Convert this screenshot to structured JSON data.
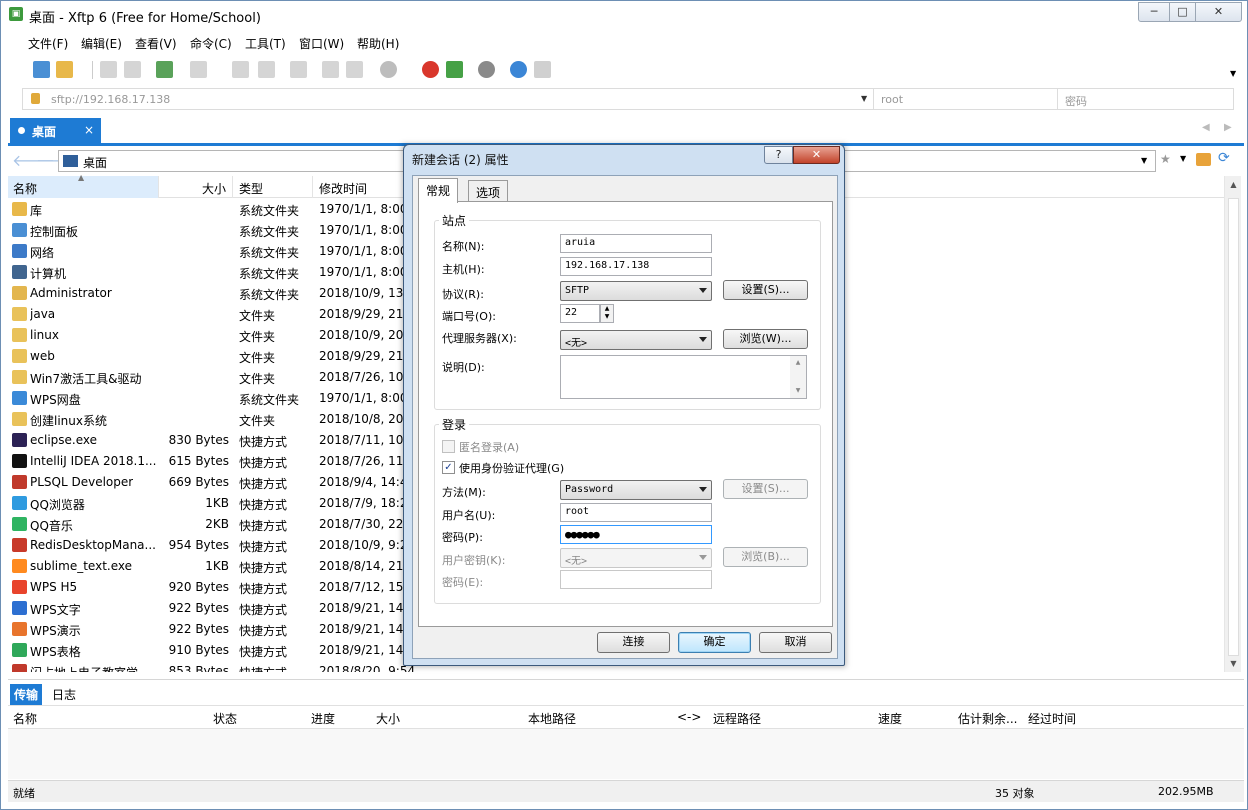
{
  "window": {
    "title": "桌面 - Xftp 6 (Free for Home/School)",
    "min": "─",
    "max": "□",
    "close": "✕"
  },
  "menu": [
    "文件(F)",
    "编辑(E)",
    "查看(V)",
    "命令(C)",
    "工具(T)",
    "窗口(W)",
    "帮助(H)"
  ],
  "address": {
    "url": "sftp://192.168.17.138",
    "user_placeholder": "root",
    "password_placeholder": "密码"
  },
  "tab": {
    "label": "桌面",
    "close": "×"
  },
  "nav": {
    "path": "桌面"
  },
  "columns": {
    "name": "名称",
    "size": "大小",
    "type": "类型",
    "modified": "修改时间"
  },
  "files": [
    {
      "name": "库",
      "size": "",
      "type": "系统文件夹",
      "modified": "1970/1/1, 8:00",
      "icon": "library-icon",
      "color": "#e8b84a"
    },
    {
      "name": "控制面板",
      "size": "",
      "type": "系统文件夹",
      "modified": "1970/1/1, 8:00",
      "icon": "control-panel-icon",
      "color": "#4a8fd4"
    },
    {
      "name": "网络",
      "size": "",
      "type": "系统文件夹",
      "modified": "1970/1/1, 8:00",
      "icon": "network-icon",
      "color": "#3c7ac8"
    },
    {
      "name": "计算机",
      "size": "",
      "type": "系统文件夹",
      "modified": "1970/1/1, 8:00",
      "icon": "computer-icon",
      "color": "#40658f"
    },
    {
      "name": "Administrator",
      "size": "",
      "type": "系统文件夹",
      "modified": "2018/10/9, 13:",
      "icon": "user-folder-icon",
      "color": "#e3b64e"
    },
    {
      "name": "java",
      "size": "",
      "type": "文件夹",
      "modified": "2018/9/29, 21:",
      "icon": "folder-icon",
      "color": "#e9c25a"
    },
    {
      "name": "linux",
      "size": "",
      "type": "文件夹",
      "modified": "2018/10/9, 20:",
      "icon": "folder-icon",
      "color": "#e9c25a"
    },
    {
      "name": "web",
      "size": "",
      "type": "文件夹",
      "modified": "2018/9/29, 21:",
      "icon": "folder-icon",
      "color": "#e9c25a"
    },
    {
      "name": "Win7激活工具&驱动",
      "size": "",
      "type": "文件夹",
      "modified": "2018/7/26, 10:",
      "icon": "folder-icon",
      "color": "#e9c25a"
    },
    {
      "name": "WPS网盘",
      "size": "",
      "type": "系统文件夹",
      "modified": "1970/1/1, 8:00",
      "icon": "cloud-drive-icon",
      "color": "#3b8ad8"
    },
    {
      "name": "创建linux系统",
      "size": "",
      "type": "文件夹",
      "modified": "2018/10/8, 20:",
      "icon": "folder-icon",
      "color": "#e9c25a"
    },
    {
      "name": "eclipse.exe",
      "size": "830 Bytes",
      "type": "快捷方式",
      "modified": "2018/7/11, 10:",
      "icon": "eclipse-icon",
      "color": "#2c2255"
    },
    {
      "name": "IntelliJ IDEA 2018.1....",
      "size": "615 Bytes",
      "type": "快捷方式",
      "modified": "2018/7/26, 11:",
      "icon": "intellij-icon",
      "color": "#111111"
    },
    {
      "name": "PLSQL Developer",
      "size": "669 Bytes",
      "type": "快捷方式",
      "modified": "2018/9/4, 14:4",
      "icon": "plsql-icon",
      "color": "#c0392b"
    },
    {
      "name": "QQ浏览器",
      "size": "1KB",
      "type": "快捷方式",
      "modified": "2018/7/9, 18:2",
      "icon": "qq-browser-icon",
      "color": "#2f9be0"
    },
    {
      "name": "QQ音乐",
      "size": "2KB",
      "type": "快捷方式",
      "modified": "2018/7/30, 22:",
      "icon": "qq-music-icon",
      "color": "#2fb462"
    },
    {
      "name": "RedisDesktopMana...",
      "size": "954 Bytes",
      "type": "快捷方式",
      "modified": "2018/10/9, 9:2",
      "icon": "redis-icon",
      "color": "#c83a2a"
    },
    {
      "name": "sublime_text.exe",
      "size": "1KB",
      "type": "快捷方式",
      "modified": "2018/8/14, 21:",
      "icon": "sublime-icon",
      "color": "#ff8a1f"
    },
    {
      "name": "WPS H5",
      "size": "920 Bytes",
      "type": "快捷方式",
      "modified": "2018/7/12, 15:",
      "icon": "wps-h5-icon",
      "color": "#e8442c"
    },
    {
      "name": "WPS文字",
      "size": "922 Bytes",
      "type": "快捷方式",
      "modified": "2018/9/21, 14:",
      "icon": "wps-writer-icon",
      "color": "#2d6fd1"
    },
    {
      "name": "WPS演示",
      "size": "922 Bytes",
      "type": "快捷方式",
      "modified": "2018/9/21, 14:",
      "icon": "wps-presentation-icon",
      "color": "#e8742c"
    },
    {
      "name": "WPS表格",
      "size": "910 Bytes",
      "type": "快捷方式",
      "modified": "2018/9/21, 14:",
      "icon": "wps-spreadsheet-icon",
      "color": "#2fa85a"
    },
    {
      "name": "闪占地上电子教室学",
      "size": "853 Bytes",
      "type": "快捷方式",
      "modified": "2018/8/20, 9:54",
      "icon": "shortcut-icon",
      "color": "#c0392b"
    }
  ],
  "bottom_tabs": [
    "传输",
    "日志"
  ],
  "transfer_columns": [
    "名称",
    "状态",
    "进度",
    "大小",
    "本地路径",
    "<->",
    "远程路径",
    "速度",
    "估计剩余...",
    "经过时间"
  ],
  "status": {
    "left": "就绪",
    "count": "35 对象",
    "size": "202.95MB"
  },
  "dialog": {
    "title": "新建会话 (2) 属性",
    "help": "?",
    "close": "✕",
    "tabs": [
      "常规",
      "选项"
    ],
    "site_group": "站点",
    "name_label": "名称(N):",
    "name_value": "aruia",
    "host_label": "主机(H):",
    "host_value": "192.168.17.138",
    "protocol_label": "协议(R):",
    "protocol_value": "SFTP",
    "settings_btn": "设置(S)...",
    "port_label": "端口号(O):",
    "port_value": "22",
    "proxy_label": "代理服务器(X):",
    "proxy_value": "<无>",
    "browse_btn": "浏览(W)...",
    "desc_label": "说明(D):",
    "login_group": "登录",
    "anon_label": "匿名登录(A)",
    "agent_label": "使用身份验证代理(G)",
    "agent_checked": "✓",
    "method_label": "方法(M):",
    "method_value": "Password",
    "method_settings_btn": "设置(S)...",
    "user_label": "用户名(U):",
    "user_value": "root",
    "pass_label": "密码(P):",
    "pass_value": "●●●●●●",
    "userkey_label": "用户密钥(K):",
    "userkey_value": "<无>",
    "userkey_browse_btn": "浏览(B)...",
    "passphrase_label": "密码(E):",
    "connect_btn": "连接",
    "ok_btn": "确定",
    "cancel_btn": "取消"
  }
}
